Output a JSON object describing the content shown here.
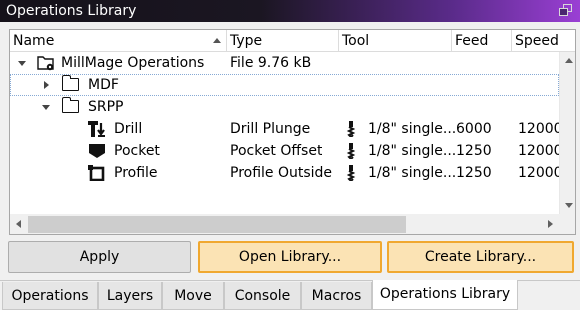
{
  "window": {
    "title": "Operations Library"
  },
  "tree": {
    "columns": [
      "Name",
      "Type",
      "Tool",
      "Feed",
      "Speed"
    ],
    "rows": [
      {
        "name": "MillMage Operations",
        "type": "File 9.76 kB",
        "tool": "",
        "feed": "",
        "speed": "",
        "icon": "millmage-file-icon",
        "expanded": true
      },
      {
        "name": "MDF",
        "type": "",
        "tool": "",
        "feed": "",
        "speed": "",
        "icon": "folder-icon",
        "expanded": false,
        "selected": true
      },
      {
        "name": "SRPP",
        "type": "",
        "tool": "",
        "feed": "",
        "speed": "",
        "icon": "folder-icon",
        "expanded": true
      },
      {
        "name": "Drill",
        "type": "Drill Plunge",
        "tool": "1/8\" single...",
        "feed": "6000",
        "speed": "12000",
        "icon": "drill-op-icon"
      },
      {
        "name": "Pocket",
        "type": "Pocket Offset",
        "tool": "1/8\" single...",
        "feed": "1250",
        "speed": "12000",
        "icon": "pocket-op-icon"
      },
      {
        "name": "Profile",
        "type": "Profile Outside",
        "tool": "1/8\" single...",
        "feed": "1250",
        "speed": "12000",
        "icon": "profile-op-icon"
      }
    ]
  },
  "buttons": {
    "apply": "Apply",
    "open_library": "Open Library...",
    "create_library": "Create Library..."
  },
  "tabs": [
    "Operations",
    "Layers",
    "Move",
    "Console",
    "Macros",
    "Operations Library"
  ],
  "active_tab": "Operations Library",
  "colors": {
    "highlight_border": "#f0a830",
    "highlight_fill": "#fbe3b4",
    "title_gradient_end": "#9a3fd4"
  }
}
